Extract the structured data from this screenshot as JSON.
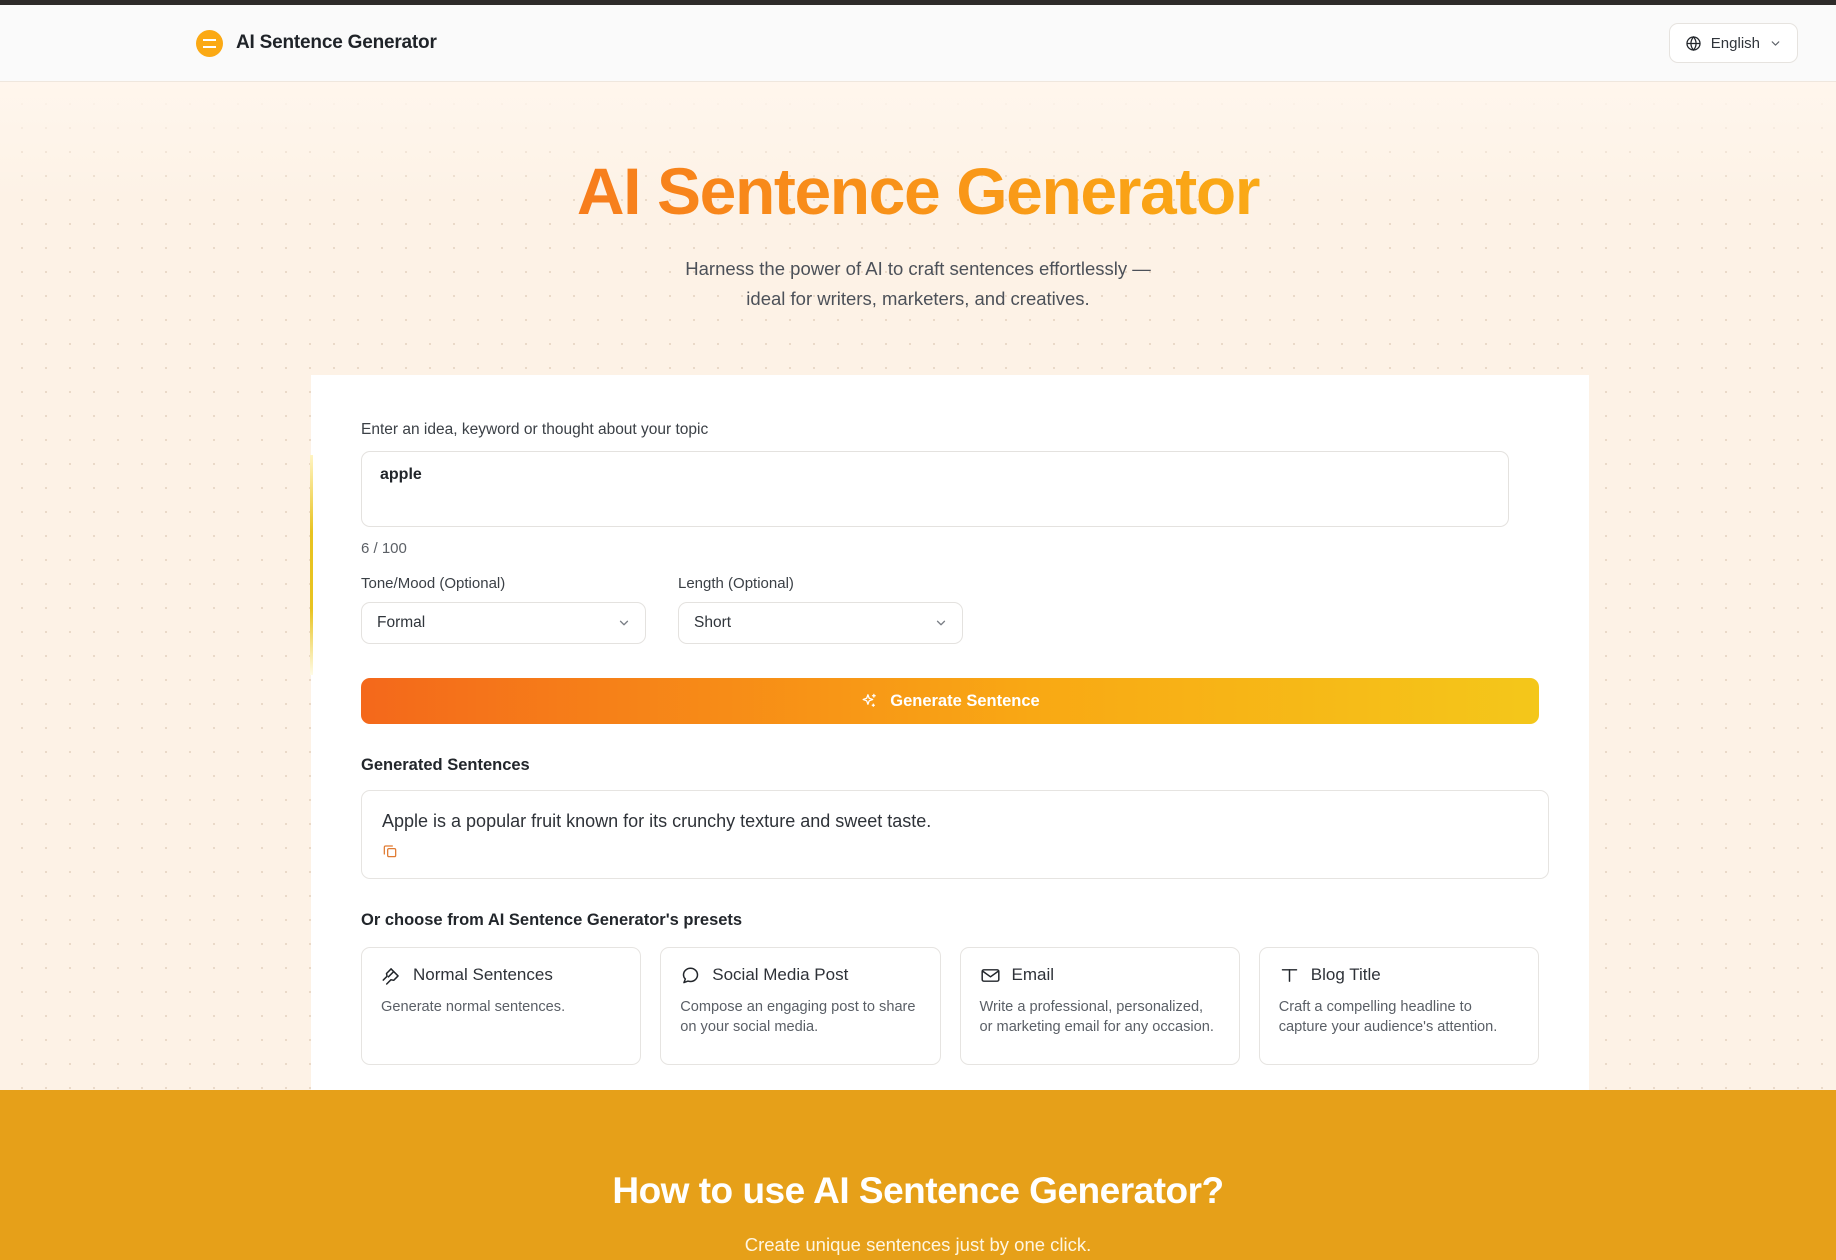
{
  "header": {
    "brand_name": "AI Sentence Generator",
    "logo_icon": "circle-minus-icon",
    "language": {
      "label": "English",
      "globe_icon": "globe-icon",
      "chevron_icon": "chevron-down-icon"
    }
  },
  "hero": {
    "title": "AI Sentence Generator",
    "subtitle_line1": "Harness the power of AI to craft sentences effortlessly —",
    "subtitle_line2": "ideal for writers, marketers, and creatives."
  },
  "form": {
    "topic_label": "Enter an idea, keyword or thought about your topic",
    "topic_value": "apple",
    "topic_placeholder": "Enter an idea, keyword or thought about your topic",
    "char_count": "6 / 100",
    "tone": {
      "label": "Tone/Mood (Optional)",
      "value": "Formal",
      "chevron_icon": "chevron-down-icon"
    },
    "length": {
      "label": "Length (Optional)",
      "value": "Short",
      "chevron_icon": "chevron-down-icon"
    },
    "generate_label": "Generate Sentence",
    "generate_icon": "sparkles-icon"
  },
  "results": {
    "title": "Generated Sentences",
    "sentence": "Apple is a popular fruit known for its crunchy texture and sweet taste.",
    "copy_icon": "copy-icon"
  },
  "presets": {
    "title": "Or choose from AI Sentence Generator's presets",
    "items": [
      {
        "icon": "pen-nib-icon",
        "name": "Normal Sentences",
        "desc": "Generate normal sentences."
      },
      {
        "icon": "chat-bubble-icon",
        "name": "Social Media Post",
        "desc": "Compose an engaging post to share on your social media."
      },
      {
        "icon": "envelope-icon",
        "name": "Email",
        "desc": "Write a professional, personalized, or marketing email for any occasion."
      },
      {
        "icon": "text-type-icon",
        "name": "Blog Title",
        "desc": "Craft a compelling headline to capture your audience's attention."
      }
    ]
  },
  "howto": {
    "title": "How to use AI Sentence Generator?",
    "subtitle": "Create unique sentences just by one click."
  },
  "colors": {
    "brand_orange": "#FBA914",
    "gradient_start": "#F4561E",
    "gradient_end": "#F7C81A",
    "band_amber": "#E6A019",
    "page_cream": "#FDF2E6",
    "accent_yellow": "#E8C320"
  }
}
